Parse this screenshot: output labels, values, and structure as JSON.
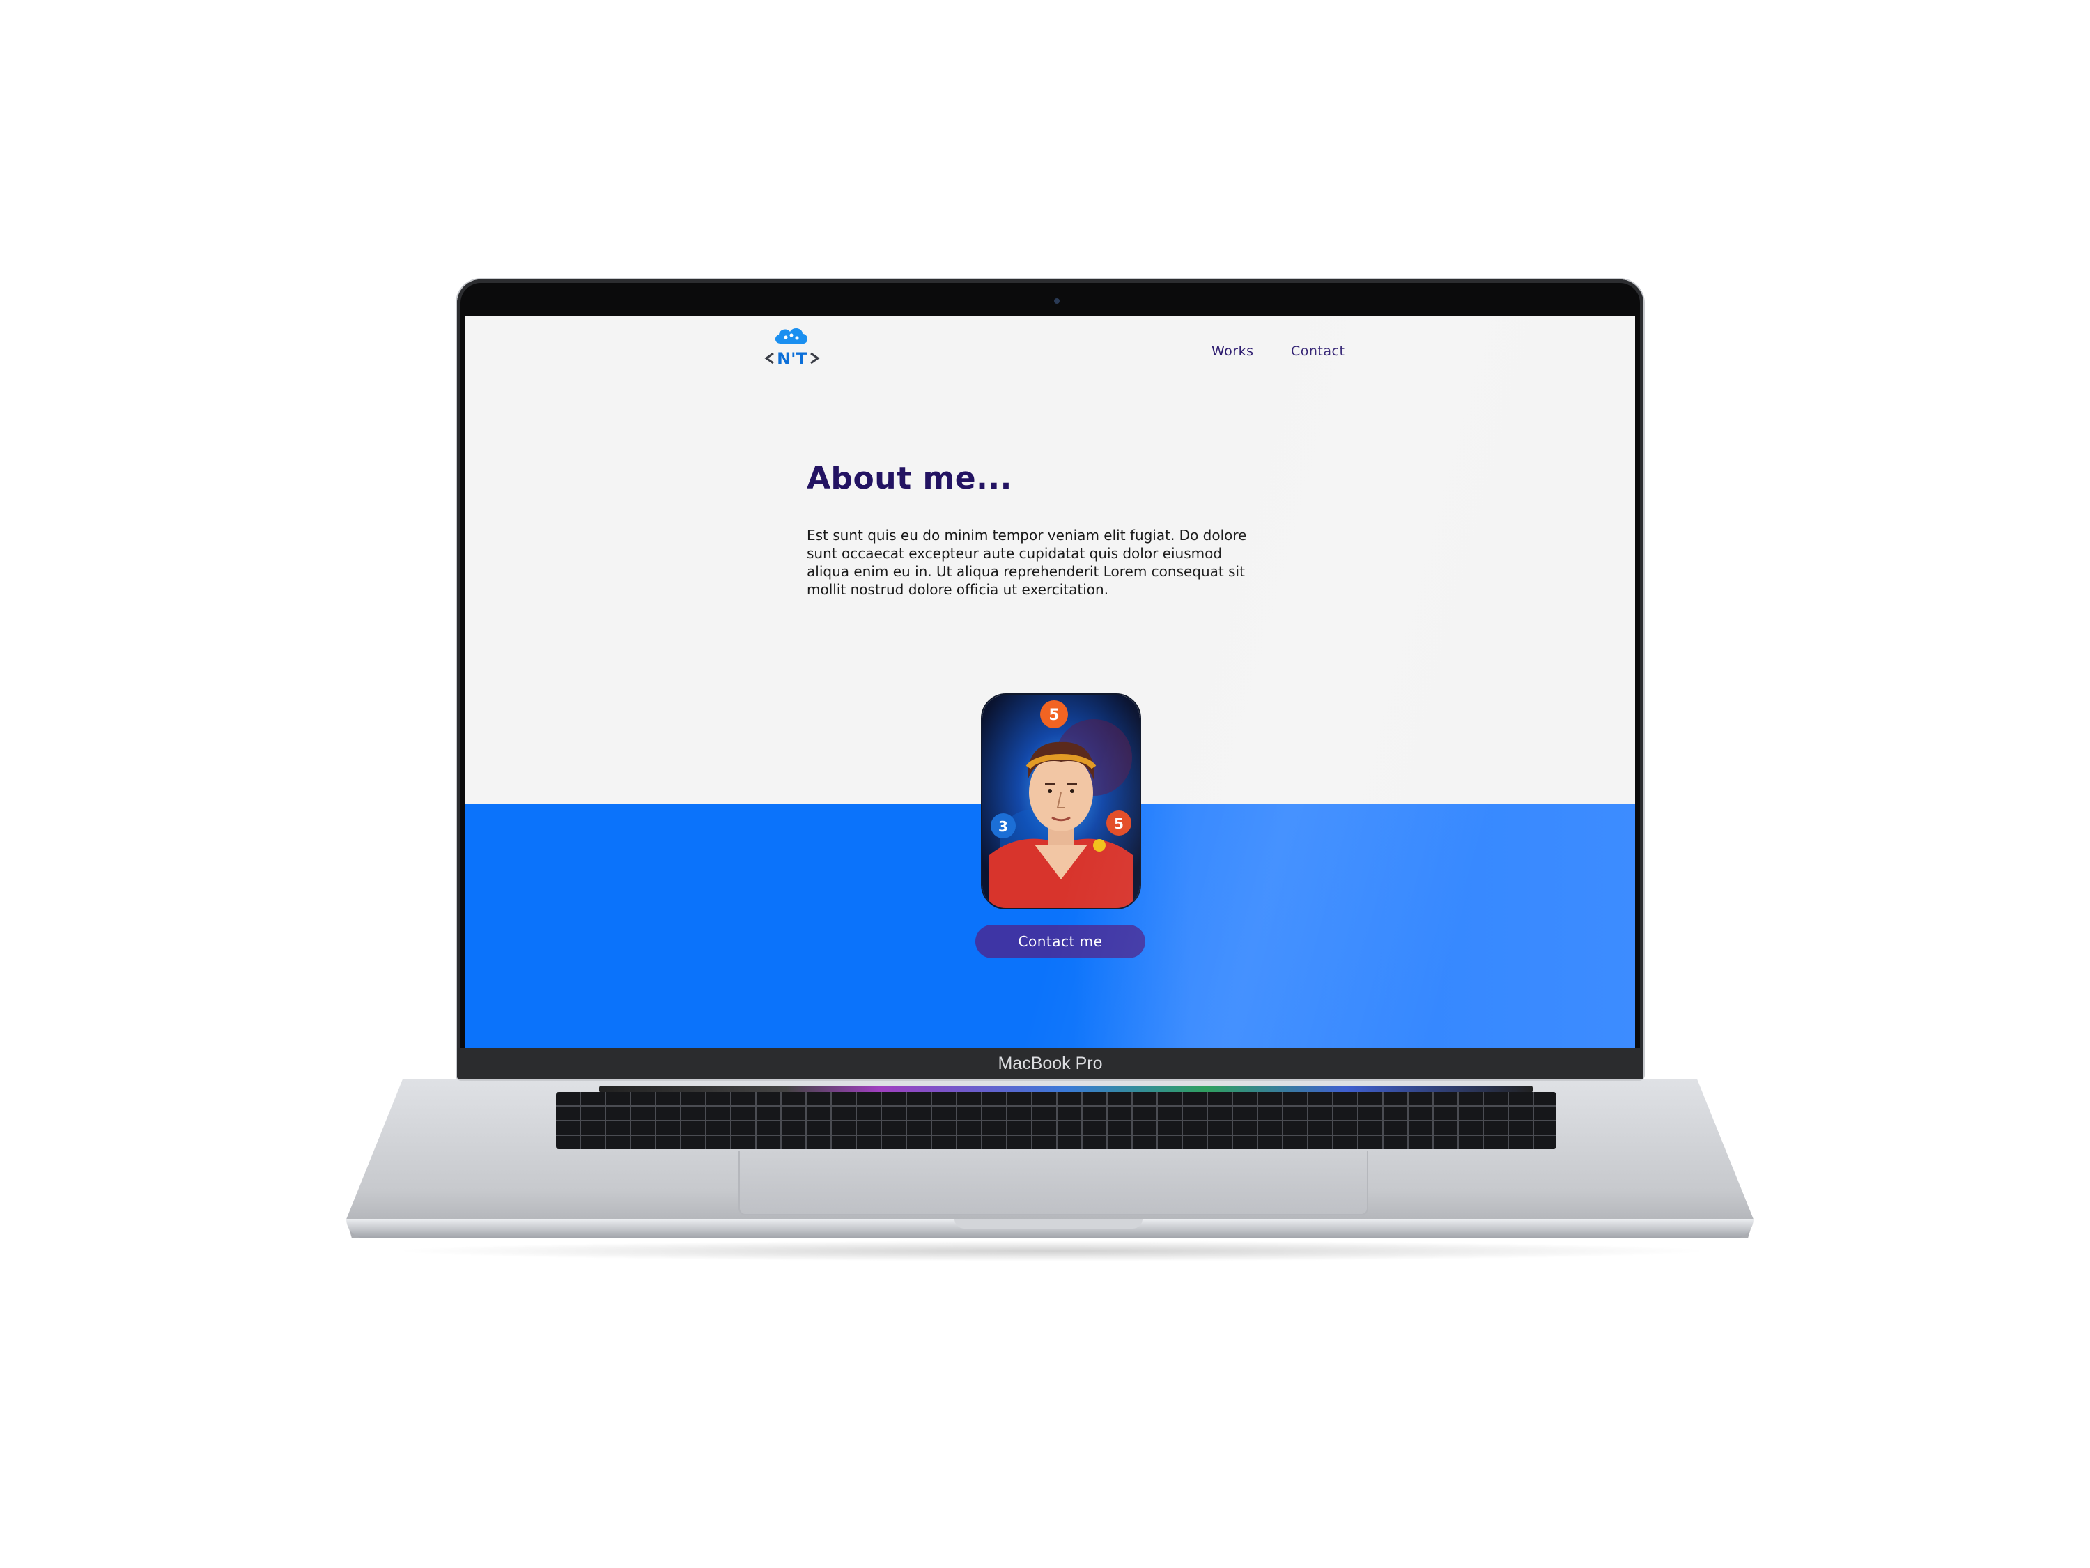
{
  "device": {
    "model_label": "MacBook Pro"
  },
  "site": {
    "logo": {
      "text": "N'T",
      "icon": "cloud-brackets-logo"
    },
    "nav": [
      {
        "label": "Works"
      },
      {
        "label": "Contact"
      }
    ],
    "about": {
      "title": "About me...",
      "body": "Est sunt quis eu do minim tempor veniam elit fugiat. Do dolore sunt occaecat excepteur aute cupidatat quis dolor eiusmod aliqua enim eu in. Ut aliqua reprehenderit Lorem consequat sit mollit nostrud dolore officia ut exercitation."
    },
    "avatar": {
      "icon": "developer-portrait-illustration",
      "badges": [
        "5",
        "3",
        "5"
      ]
    },
    "cta": {
      "label": "Contact me"
    },
    "colors": {
      "heading": "#231362",
      "band": "#0b73fb",
      "button": "#3e35a5",
      "page_bg": "#f4f4f4"
    }
  }
}
